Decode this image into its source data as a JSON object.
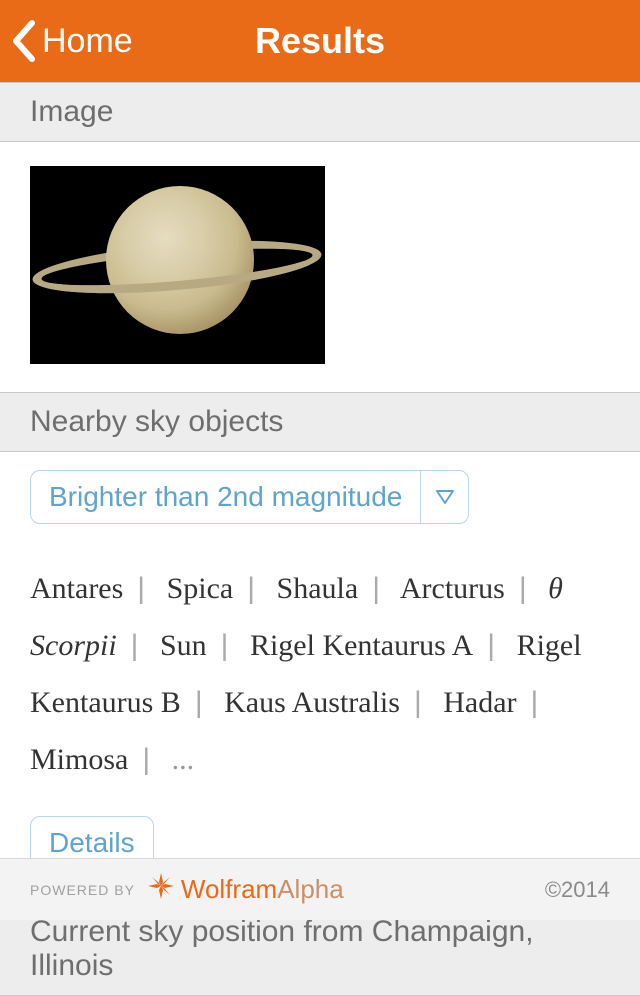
{
  "header": {
    "back_label": "Home",
    "title": "Results"
  },
  "image_pod": {
    "title": "Image"
  },
  "nearby_pod": {
    "title": "Nearby sky objects",
    "filter_label": "Brighter than 2nd magnitude",
    "objects": [
      "Antares",
      "Spica",
      "Shaula",
      "Arcturus",
      "θ Scorpii",
      "Sun",
      "Rigel Kentaurus A",
      "Rigel Kentaurus B",
      "Kaus Australis",
      "Hadar",
      "Mimosa"
    ],
    "ellipsis": "...",
    "details_label": "Details"
  },
  "sky_pod": {
    "title": "Current sky position from Champaign, Illinois"
  },
  "footer": {
    "powered_by": "POWERED BY",
    "brand_a": "Wolfram",
    "brand_b": "Alpha",
    "copyright": "©2014"
  }
}
